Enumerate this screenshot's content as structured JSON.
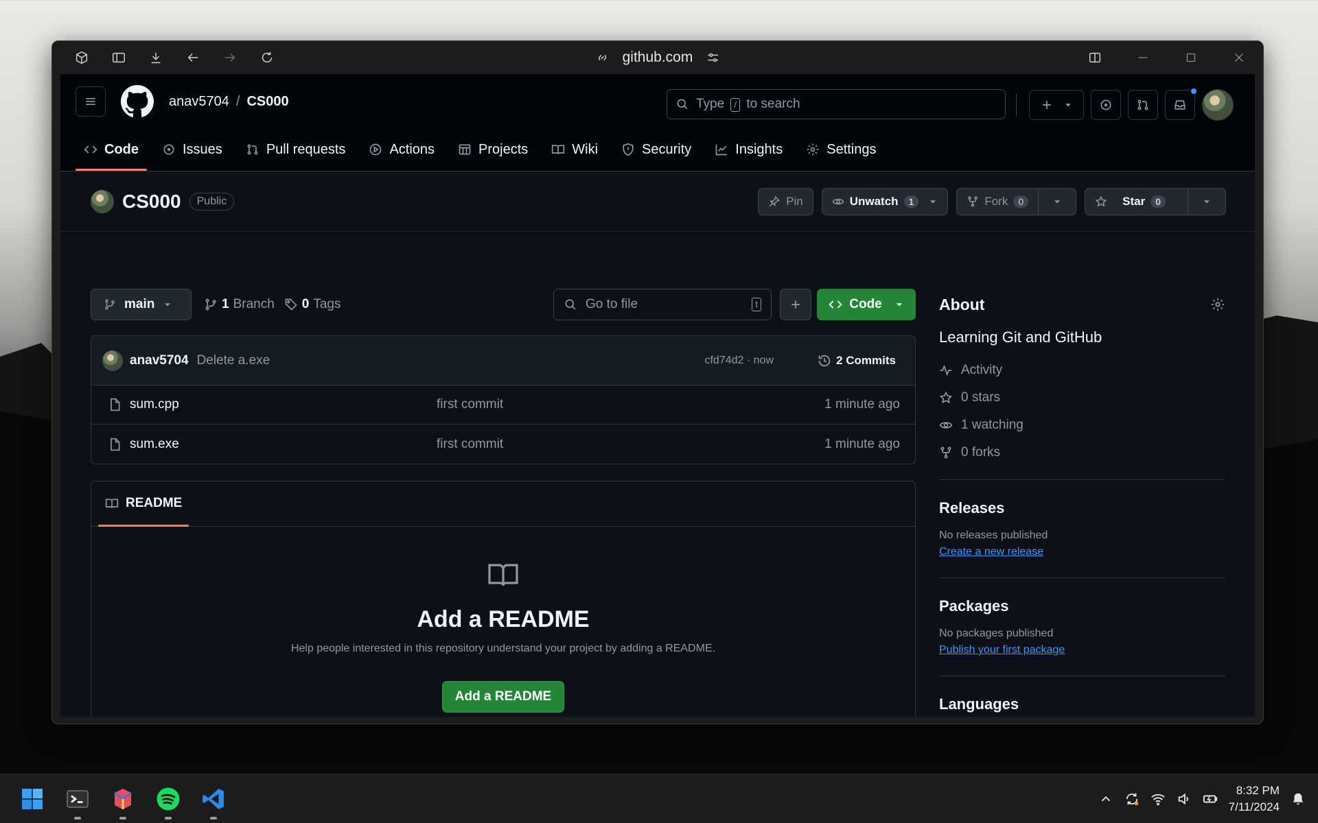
{
  "browser": {
    "url": "github.com"
  },
  "header": {
    "owner": "anav5704",
    "separator": "/",
    "repo": "CS000",
    "search_prefix": "Type",
    "search_key": "/",
    "search_suffix": "to search"
  },
  "nav": {
    "tabs": [
      {
        "label": "Code",
        "icon": "code-icon",
        "active": true
      },
      {
        "label": "Issues",
        "icon": "issue-icon"
      },
      {
        "label": "Pull requests",
        "icon": "pull-request-icon"
      },
      {
        "label": "Actions",
        "icon": "play-icon"
      },
      {
        "label": "Projects",
        "icon": "table-icon"
      },
      {
        "label": "Wiki",
        "icon": "book-icon"
      },
      {
        "label": "Security",
        "icon": "shield-icon"
      },
      {
        "label": "Insights",
        "icon": "graph-icon"
      },
      {
        "label": "Settings",
        "icon": "gear-icon"
      }
    ]
  },
  "repo_head": {
    "title": "CS000",
    "visibility": "Public",
    "pin_label": "Pin",
    "unwatch_label": "Unwatch",
    "watch_count": "1",
    "fork_label": "Fork",
    "fork_count": "0",
    "star_label": "Star",
    "star_count": "0"
  },
  "toolbar": {
    "branch": "main",
    "branch_count": "1",
    "branch_label": "Branch",
    "tag_count": "0",
    "tag_label": "Tags",
    "go_to_file": "Go to file",
    "go_to_file_key": "t",
    "code_label": "Code"
  },
  "commit": {
    "author": "anav5704",
    "message": "Delete a.exe",
    "hash_time": "cfd74d2 · now",
    "commits_label": "2 Commits"
  },
  "files": [
    {
      "name": "sum.cpp",
      "message": "first commit",
      "time": "1 minute ago"
    },
    {
      "name": "sum.exe",
      "message": "first commit",
      "time": "1 minute ago"
    }
  ],
  "readme": {
    "tab_label": "README",
    "title": "Add a README",
    "description": "Help people interested in this repository understand your project by adding a README.",
    "button": "Add a README"
  },
  "about": {
    "heading": "About",
    "description": "Learning Git and GitHub",
    "stats": [
      {
        "label": "Activity",
        "icon": "pulse-icon"
      },
      {
        "label": "0 stars",
        "icon": "star-icon"
      },
      {
        "label": "1 watching",
        "icon": "eye-icon"
      },
      {
        "label": "0 forks",
        "icon": "fork-icon"
      }
    ],
    "releases_heading": "Releases",
    "releases_note": "No releases published",
    "releases_link": "Create a new release",
    "packages_heading": "Packages",
    "packages_note": "No packages published",
    "packages_link": "Publish your first package",
    "languages_heading": "Languages"
  },
  "taskbar": {
    "time": "8:32 PM",
    "date": "7/11/2024"
  },
  "colors": {
    "accent_green": "#238636",
    "link_blue": "#4493f8",
    "tab_underline": "#f78166",
    "page_bg": "#0d1117"
  }
}
